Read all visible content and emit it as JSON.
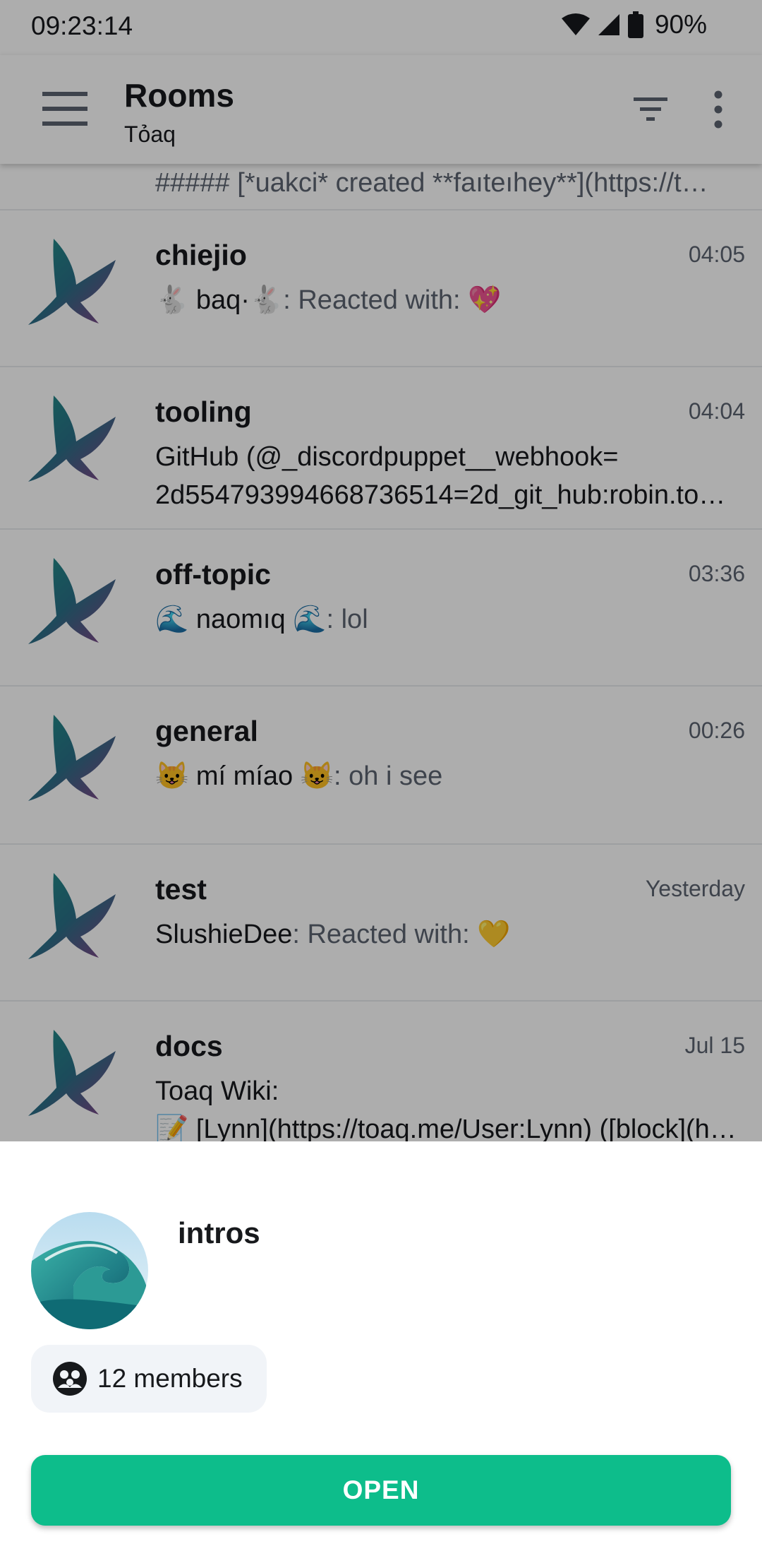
{
  "status_bar": {
    "time": "09:23:14",
    "battery": "90%"
  },
  "app_bar": {
    "title": "Rooms",
    "subtitle": "Tỏaq",
    "menu_icon": "menu-icon",
    "filter_icon": "filter-icon",
    "more_icon": "more-vert-icon"
  },
  "rooms": [
    {
      "name": "",
      "time": "",
      "preview": "##### [*uakci* created **faıteıhey**](https://t…"
    },
    {
      "name": "chiejio",
      "time": "04:05",
      "sender": "🐇 baq·🐇",
      "message": ": Reacted with: 💖"
    },
    {
      "name": "tooling",
      "time": "04:04",
      "line1": "GitHub (@_discordpuppet__webhook=",
      "line2": "2d554793994668736514=2d_git_hub:robin.to…"
    },
    {
      "name": "off-topic",
      "time": "03:36",
      "sender": "🌊 naomıq 🌊",
      "message": ": lol"
    },
    {
      "name": "general",
      "time": "00:26",
      "sender": "😺 mí míao 😺",
      "message": ": oh i see"
    },
    {
      "name": "test",
      "time": "Yesterday",
      "sender": "SlushieDee",
      "message": ": Reacted with: 💛"
    },
    {
      "name": "docs",
      "time": "Jul 15",
      "line1": "Toaq Wiki:",
      "line2": "📝 [Lynn](https://toaq.me/User:Lynn) ([block](h…"
    }
  ],
  "sheet": {
    "title": "intros",
    "members": "12 members",
    "open_label": "OPEN"
  },
  "colors": {
    "accent": "#0dbd8b",
    "scrim": "rgba(0,0,0,0.32)",
    "chip_bg": "#f1f4f8"
  }
}
